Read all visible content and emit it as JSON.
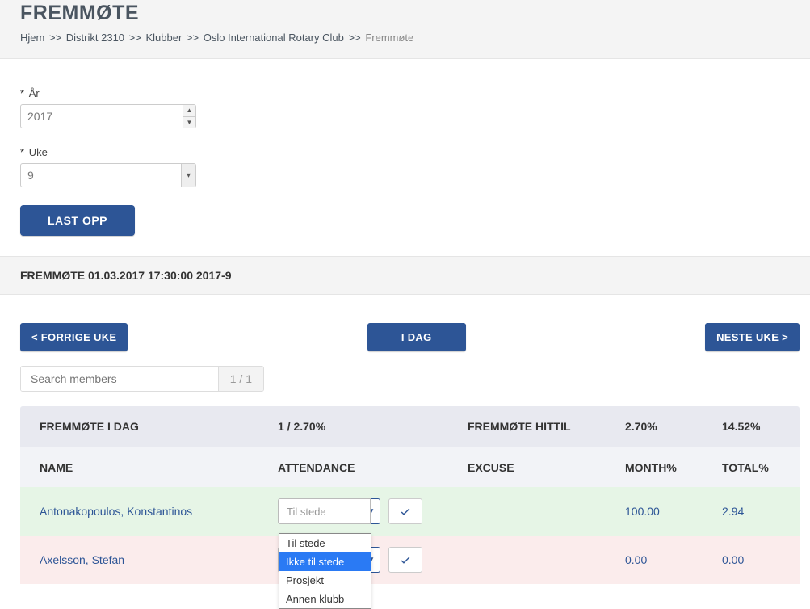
{
  "header": {
    "title": "FREMMØTE",
    "breadcrumb": {
      "home": "Hjem",
      "district": "Distrikt 2310",
      "clubs": "Klubber",
      "club": "Oslo International Rotary Club",
      "current": "Fremmøte"
    }
  },
  "form": {
    "year_label": "År",
    "year_value": "2017",
    "week_label": "Uke",
    "week_value": "9",
    "upload_btn": "LAST OPP"
  },
  "meeting_bar": "FREMMØTE 01.03.2017 17:30:00   2017-9",
  "nav": {
    "prev": "< FORRIGE UKE",
    "today": "I DAG",
    "next": "NESTE UKE >"
  },
  "search": {
    "placeholder": "Search members",
    "page": "1 / 1"
  },
  "summary": {
    "today_label": "FREMMØTE I DAG",
    "today_value": "1 / 2.70%",
    "sofar_label": "FREMMØTE HITTIL",
    "month_pct": "2.70%",
    "total_pct": "14.52%"
  },
  "columns": {
    "name": "NAME",
    "attendance": "ATTENDANCE",
    "excuse": "EXCUSE",
    "month": "MONTH%",
    "total": "TOTAL%"
  },
  "rows": [
    {
      "name": "Antonakopoulos, Konstantinos",
      "attendance": "Til stede",
      "excuse": "",
      "month": "100.00",
      "total": "2.94",
      "tone": "green"
    },
    {
      "name": "Axelsson, Stefan",
      "attendance": "",
      "excuse": "",
      "month": "0.00",
      "total": "0.00",
      "tone": "pink"
    }
  ],
  "dropdown_options": [
    "Til stede",
    "Ikke til stede",
    "Prosjekt",
    "Annen klubb"
  ],
  "dropdown_selected_index": 1
}
